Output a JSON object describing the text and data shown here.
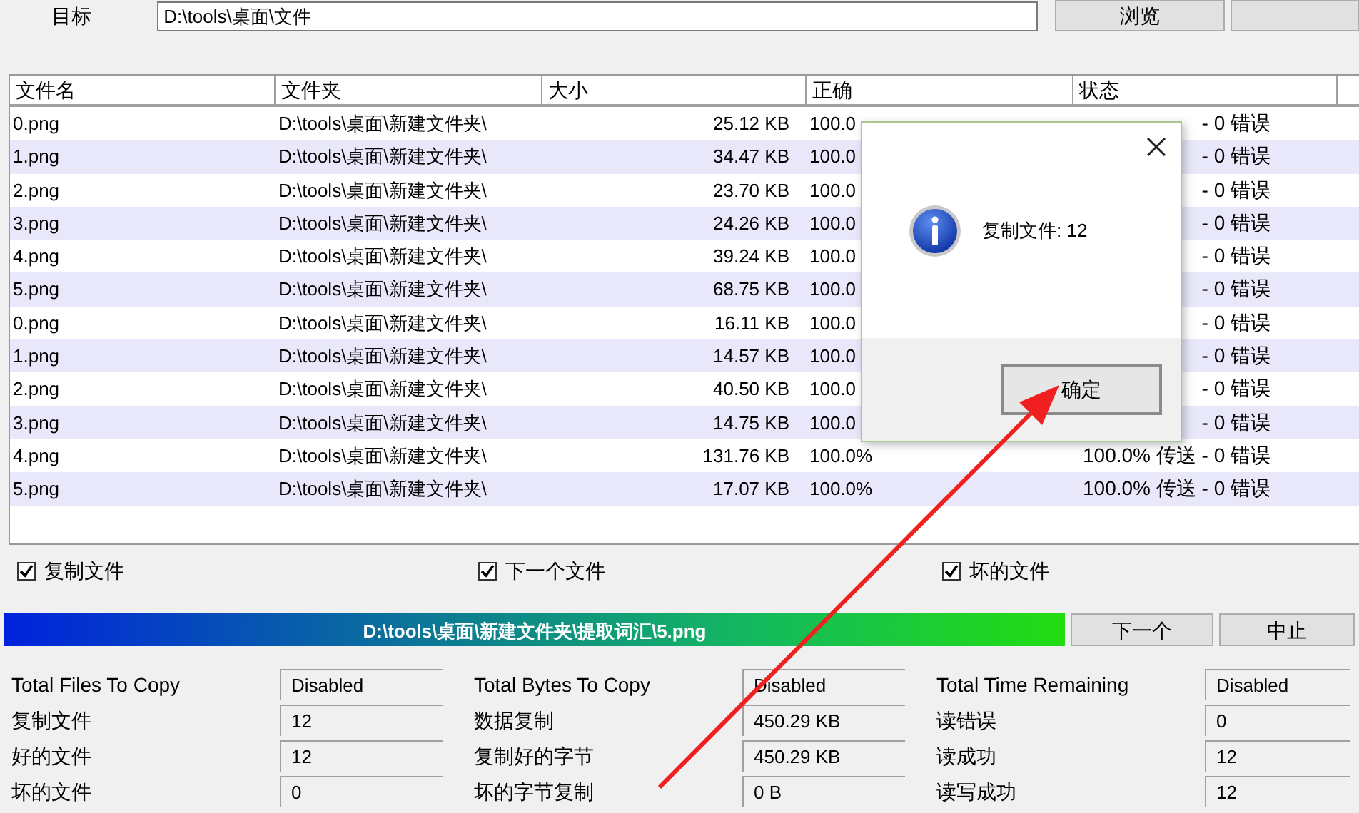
{
  "target": {
    "label": "目标",
    "value": "D:\\tools\\桌面\\文件",
    "browse": "浏览"
  },
  "table": {
    "columns": [
      "文件名",
      "文件夹",
      "大小",
      "正确",
      "状态"
    ],
    "rows": [
      {
        "name": "0.png",
        "folder": "D:\\tools\\桌面\\新建文件夹\\",
        "size": "25.12 KB",
        "correct": "100.0",
        "status": "- 0 错误"
      },
      {
        "name": "1.png",
        "folder": "D:\\tools\\桌面\\新建文件夹\\",
        "size": "34.47 KB",
        "correct": "100.0",
        "status": "- 0 错误"
      },
      {
        "name": "2.png",
        "folder": "D:\\tools\\桌面\\新建文件夹\\",
        "size": "23.70 KB",
        "correct": "100.0",
        "status": "- 0 错误"
      },
      {
        "name": "3.png",
        "folder": "D:\\tools\\桌面\\新建文件夹\\",
        "size": "24.26 KB",
        "correct": "100.0",
        "status": "- 0 错误"
      },
      {
        "name": "4.png",
        "folder": "D:\\tools\\桌面\\新建文件夹\\",
        "size": "39.24 KB",
        "correct": "100.0",
        "status": "- 0 错误"
      },
      {
        "name": "5.png",
        "folder": "D:\\tools\\桌面\\新建文件夹\\",
        "size": "68.75 KB",
        "correct": "100.0",
        "status": "- 0 错误"
      },
      {
        "name": "0.png",
        "folder": "D:\\tools\\桌面\\新建文件夹\\",
        "size": "16.11 KB",
        "correct": "100.0",
        "status": "- 0 错误"
      },
      {
        "name": "1.png",
        "folder": "D:\\tools\\桌面\\新建文件夹\\",
        "size": "14.57 KB",
        "correct": "100.0",
        "status": "- 0 错误"
      },
      {
        "name": "2.png",
        "folder": "D:\\tools\\桌面\\新建文件夹\\",
        "size": "40.50 KB",
        "correct": "100.0",
        "status": "- 0 错误"
      },
      {
        "name": "3.png",
        "folder": "D:\\tools\\桌面\\新建文件夹\\",
        "size": "14.75 KB",
        "correct": "100.0",
        "status": "- 0 错误"
      },
      {
        "name": "4.png",
        "folder": "D:\\tools\\桌面\\新建文件夹\\",
        "size": "131.76 KB",
        "correct": "100.0%",
        "status": "100.0% 传送 - 0 错误"
      },
      {
        "name": "5.png",
        "folder": "D:\\tools\\桌面\\新建文件夹\\",
        "size": "17.07 KB",
        "correct": "100.0%",
        "status": "100.0% 传送 - 0 错误"
      }
    ]
  },
  "options": [
    {
      "label": "复制文件",
      "checked": true
    },
    {
      "label": "下一个文件",
      "checked": true
    },
    {
      "label": "坏的文件",
      "checked": true
    }
  ],
  "progress": {
    "text": "D:\\tools\\桌面\\新建文件夹\\提取词汇\\5.png",
    "level": 1
  },
  "actions": [
    "下一个",
    "中止"
  ],
  "stats": [
    [
      {
        "label": "Total Files To Copy",
        "value": "Disabled"
      },
      {
        "label": "Total Bytes To Copy",
        "value": "Disabled"
      },
      {
        "label": "Total Time Remaining",
        "value": "Disabled"
      }
    ],
    [
      {
        "label": "复制文件",
        "value": "12"
      },
      {
        "label": "数据复制",
        "value": "450.29 KB"
      },
      {
        "label": "读错误",
        "value": "0"
      }
    ],
    [
      {
        "label": "好的文件",
        "value": "12"
      },
      {
        "label": "复制好的字节",
        "value": "450.29 KB"
      },
      {
        "label": "读成功",
        "value": "12"
      }
    ],
    [
      {
        "label": "坏的文件",
        "value": "0"
      },
      {
        "label": "坏的字节复制",
        "value": "0 B"
      },
      {
        "label": "读写成功",
        "value": "12"
      }
    ]
  ],
  "dialog": {
    "message": "复制文件: 12",
    "button": "确定"
  }
}
